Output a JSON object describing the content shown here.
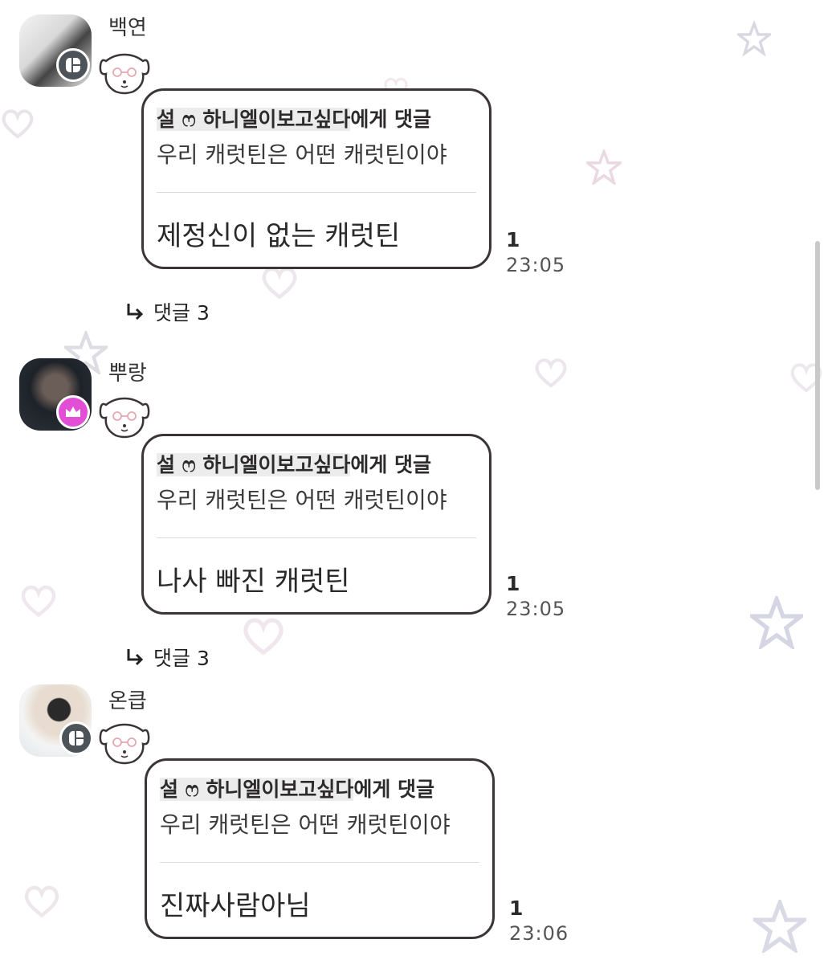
{
  "messages": [
    {
      "nickname": "백연",
      "badge": "gray",
      "reply_to_name": "설 ෆ 하니엘이보고싶다",
      "reply_to_suffix": "에게 댓글",
      "original_text": "우리 캐럿틴은 어떤 캐럿틴이야",
      "text": "제정신이 없는 캐럿틴",
      "unread": "1",
      "time": "23:05",
      "thread_label": "댓글 3"
    },
    {
      "nickname": "뿌랑",
      "badge": "pink",
      "reply_to_name": "설 ෆ 하니엘이보고싶다",
      "reply_to_suffix": "에게 댓글",
      "original_text": "우리 캐럿틴은 어떤 캐럿틴이야",
      "text": "나사 빠진 캐럿틴",
      "unread": "1",
      "time": "23:05",
      "thread_label": "댓글 3"
    },
    {
      "nickname": "온큽",
      "badge": "gray",
      "reply_to_name": "설 ෆ 하니엘이보고싶다",
      "reply_to_suffix": "에게 댓글",
      "original_text": "우리 캐럿틴은 어떤 캐럿틴이야",
      "text": "진짜사람아님",
      "unread": "1",
      "time": "23:06"
    }
  ],
  "icons": {
    "thread_arrow": "reply-arrow-icon",
    "badge_gray": "open-chat-host-icon",
    "badge_pink": "crown-icon",
    "sticker": "puppy-sticker-icon"
  },
  "colors": {
    "bubble_border": "#3b3536",
    "badge_gray": "#4d5459",
    "badge_pink": "#e24fd6",
    "highlight": "#ececec"
  }
}
